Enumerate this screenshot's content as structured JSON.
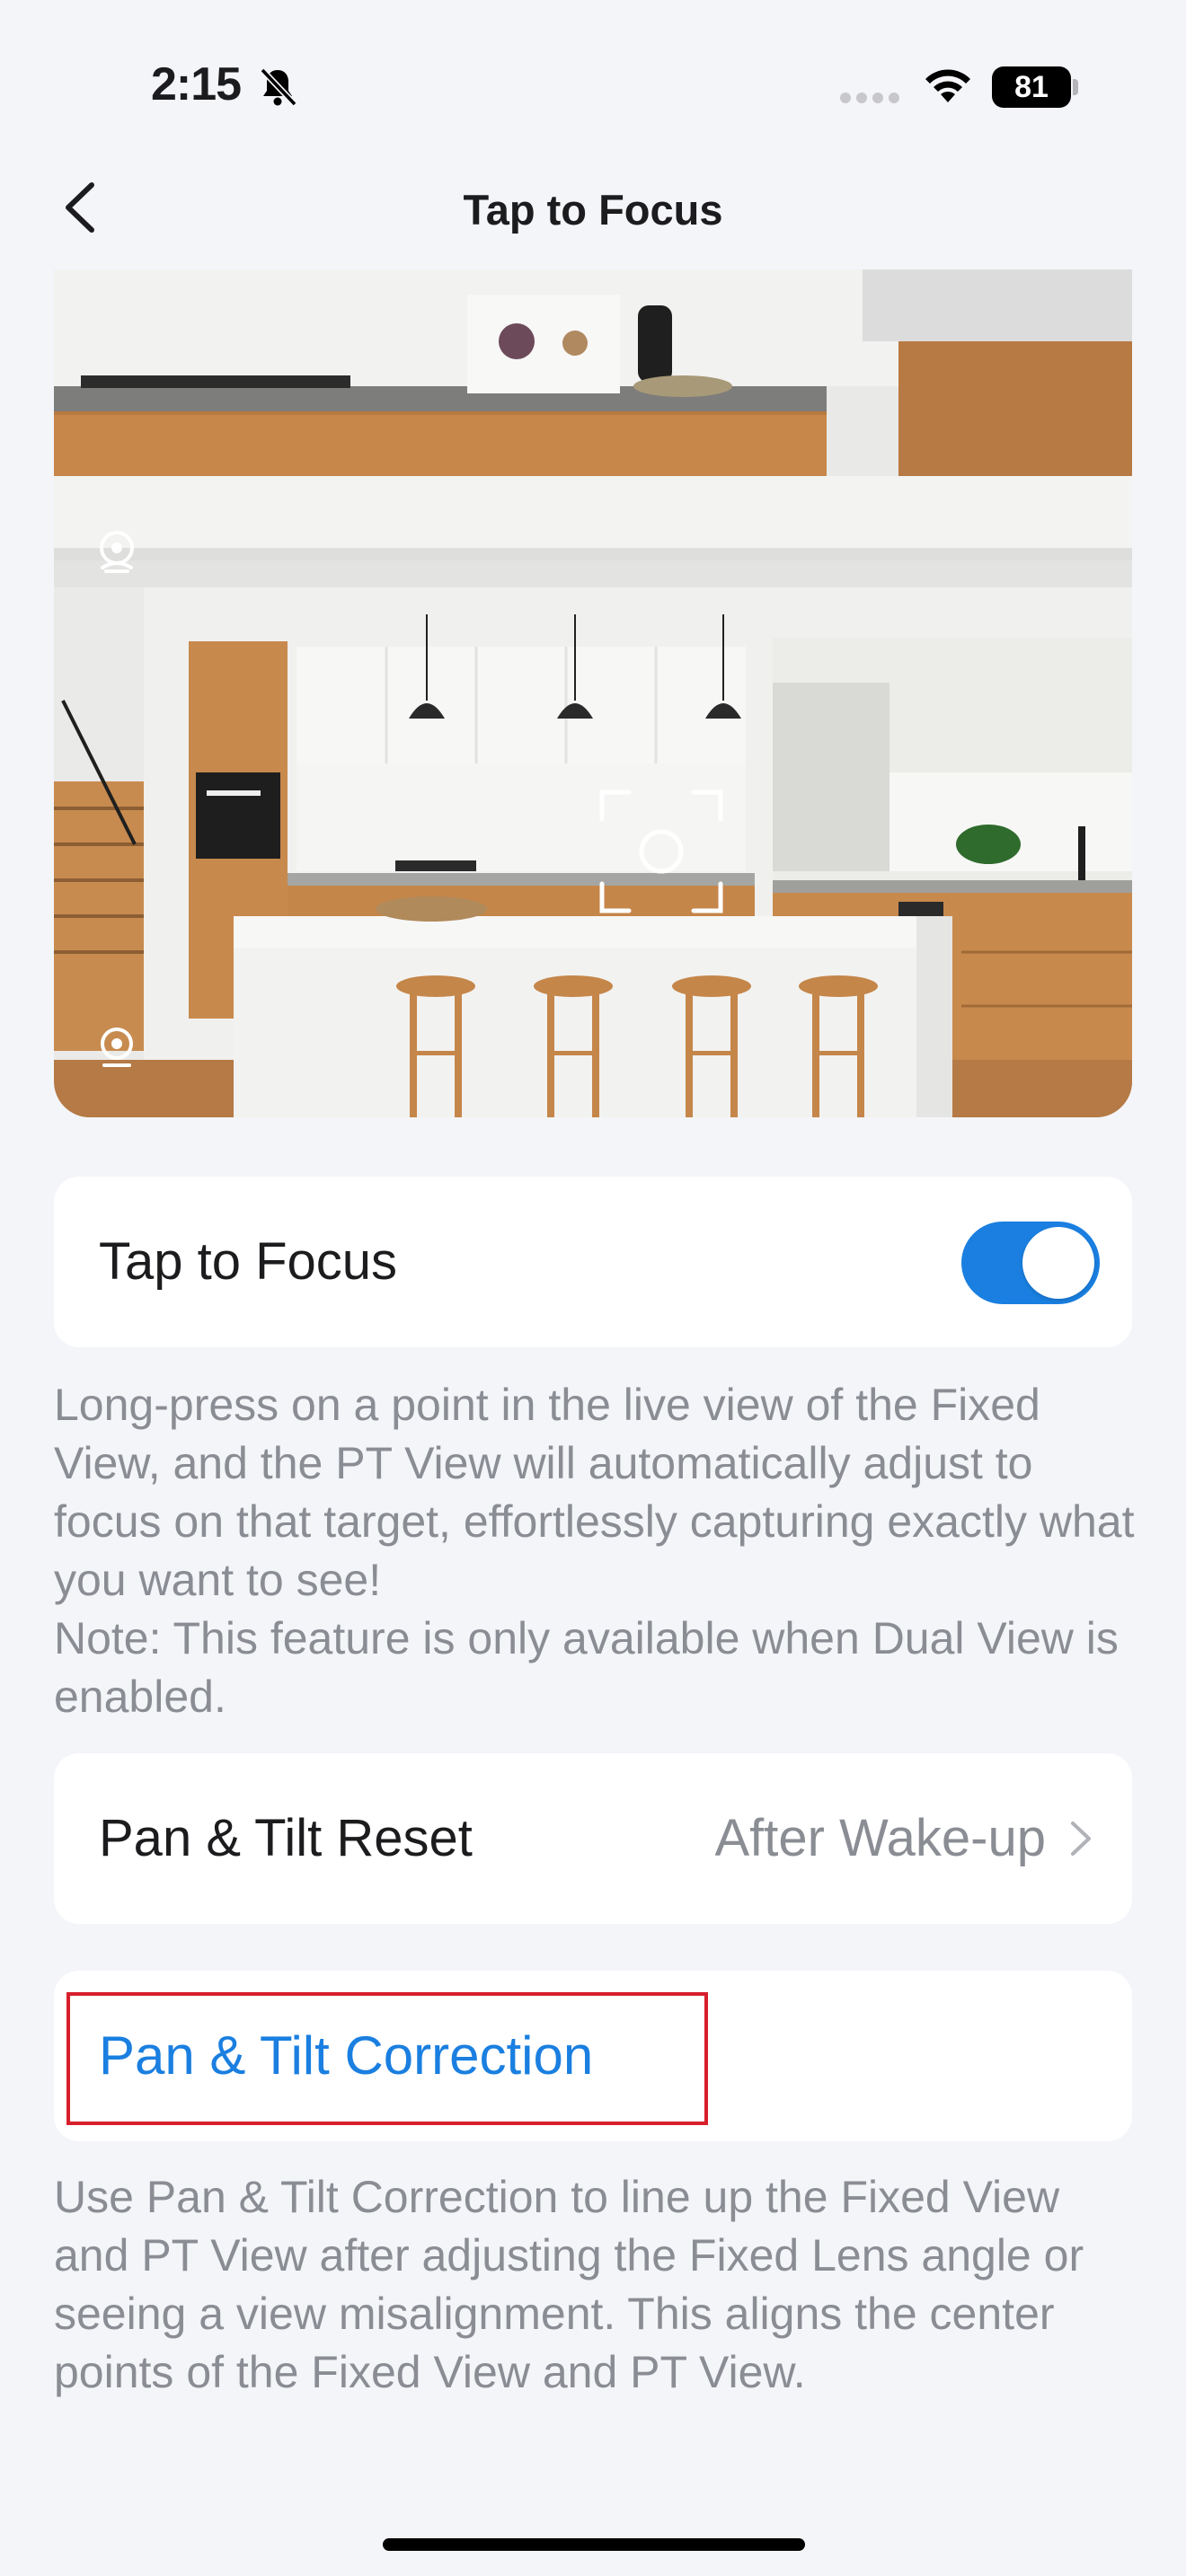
{
  "status_bar": {
    "time": "2:15",
    "battery": "81",
    "icons": [
      "bell-off-icon",
      "signal-icon",
      "wifi-icon",
      "battery-icon"
    ]
  },
  "nav": {
    "title": "Tap to Focus",
    "back_icon": "chevron-left-icon"
  },
  "live_view": {
    "icons": [
      "fixed-camera-icon",
      "pt-camera-icon",
      "focus-target-icon"
    ]
  },
  "tap_to_focus": {
    "label": "Tap to Focus",
    "enabled": true,
    "description": "Long-press on a point in the live view of the Fixed View, and the PT View will automatically adjust to focus on that target, effortlessly capturing exactly what you want to see!",
    "note": "Note: This feature is only available when Dual View is enabled."
  },
  "pan_tilt_reset": {
    "label": "Pan & Tilt Reset",
    "value": "After Wake-up"
  },
  "pan_tilt_correction": {
    "label": "Pan & Tilt Correction",
    "description": "Use Pan & Tilt Correction to line up the Fixed View and PT View after adjusting the Fixed Lens angle or seeing a view misalignment. This aligns the center points of the Fixed View and PT View."
  },
  "colors": {
    "accent": "#1a7fe0",
    "highlight": "#d71f2c",
    "secondary_text": "#8a8d93",
    "background": "#f4f5f9"
  }
}
